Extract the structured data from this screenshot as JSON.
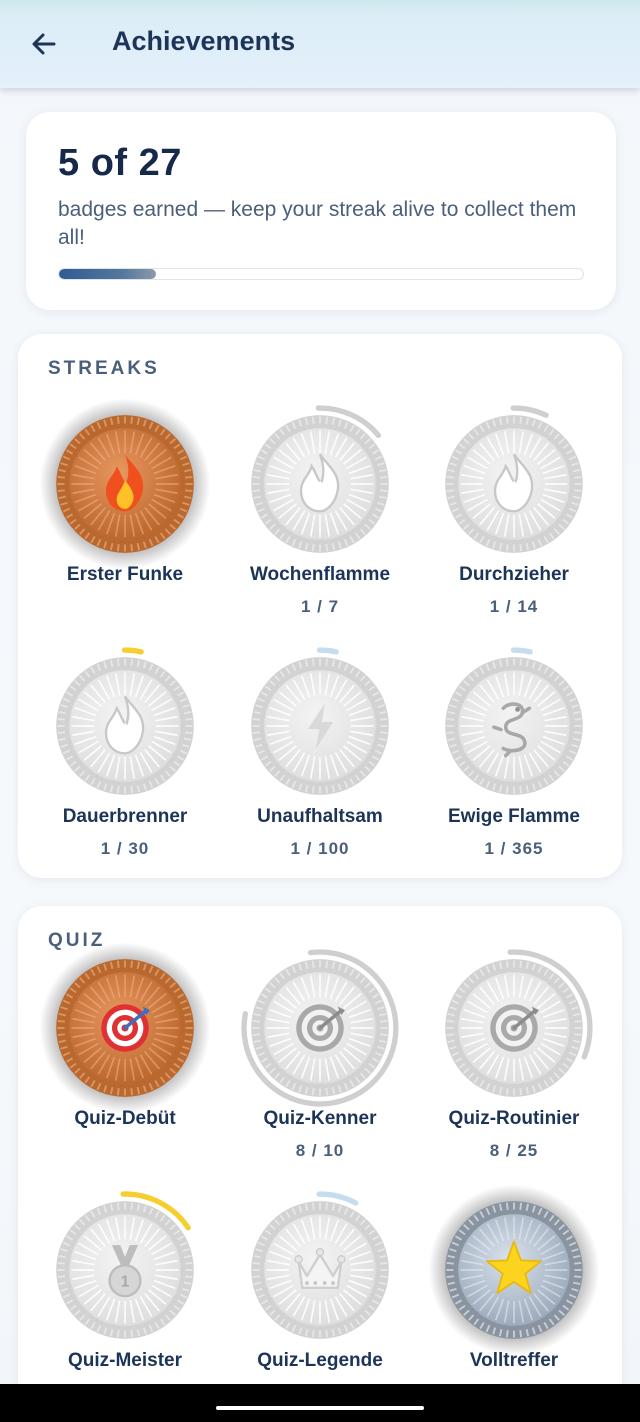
{
  "header": {
    "title": "Achievements",
    "back_icon": "arrow-left-icon"
  },
  "summary": {
    "count_text": "5 of 27",
    "subtitle": "badges earned — keep your streak alive to collect them all!",
    "earned": 5,
    "total": 27,
    "progress_fraction": 0.185
  },
  "colors": {
    "accent": "#1c3458",
    "bronze": "#c46f38",
    "silver_earned": "#b8c1cc",
    "locked": "#dcdcdc",
    "ring_locked": "#cfcfcf",
    "ring_yellow": "#f6cf2f",
    "ring_blue": "#c6dcef"
  },
  "sections": [
    {
      "title": "STREAKS",
      "badges": [
        {
          "name": "Erster Funke",
          "progress": "",
          "status": "earned",
          "tier": "bronze",
          "icon": "fire-icon",
          "fill": 1,
          "ring": "none"
        },
        {
          "name": "Wochenflamme",
          "progress": "1 / 7",
          "status": "locked",
          "tier": "locked",
          "icon": "fire-icon",
          "fill": 0.143,
          "ring": "gray"
        },
        {
          "name": "Durchzieher",
          "progress": "1 / 14",
          "status": "locked",
          "tier": "locked",
          "icon": "fire-icon",
          "fill": 0.071,
          "ring": "gray"
        },
        {
          "name": "Dauerbrenner",
          "progress": "1 / 30",
          "status": "locked",
          "tier": "locked",
          "icon": "fire-icon",
          "fill": 0.033,
          "ring": "yellow"
        },
        {
          "name": "Unaufhaltsam",
          "progress": "1 / 100",
          "status": "locked",
          "tier": "locked",
          "icon": "lightning-icon",
          "fill": 0.01,
          "ring": "blue"
        },
        {
          "name": "Ewige Flamme",
          "progress": "1 / 365",
          "status": "locked",
          "tier": "locked",
          "icon": "dragon-icon",
          "fill": 0.003,
          "ring": "blue"
        }
      ]
    },
    {
      "title": "QUIZ",
      "badges": [
        {
          "name": "Quiz-Debüt",
          "progress": "",
          "status": "earned",
          "tier": "bronze",
          "icon": "target-icon",
          "fill": 1,
          "ring": "none"
        },
        {
          "name": "Quiz-Kenner",
          "progress": "8 / 10",
          "status": "locked",
          "tier": "locked",
          "icon": "target-icon",
          "fill": 0.8,
          "ring": "gray"
        },
        {
          "name": "Quiz-Routinier",
          "progress": "8 / 25",
          "status": "locked",
          "tier": "locked",
          "icon": "target-icon",
          "fill": 0.32,
          "ring": "gray"
        },
        {
          "name": "Quiz-Meister",
          "progress": "",
          "status": "locked",
          "tier": "locked",
          "icon": "medal-icon",
          "fill": 0.16,
          "ring": "yellow"
        },
        {
          "name": "Quiz-Legende",
          "progress": "",
          "status": "locked",
          "tier": "locked",
          "icon": "crown-icon",
          "fill": 0.08,
          "ring": "blue"
        },
        {
          "name": "Volltreffer",
          "progress": "",
          "status": "earned",
          "tier": "silver",
          "icon": "star-icon",
          "fill": 1,
          "ring": "none"
        }
      ]
    }
  ]
}
